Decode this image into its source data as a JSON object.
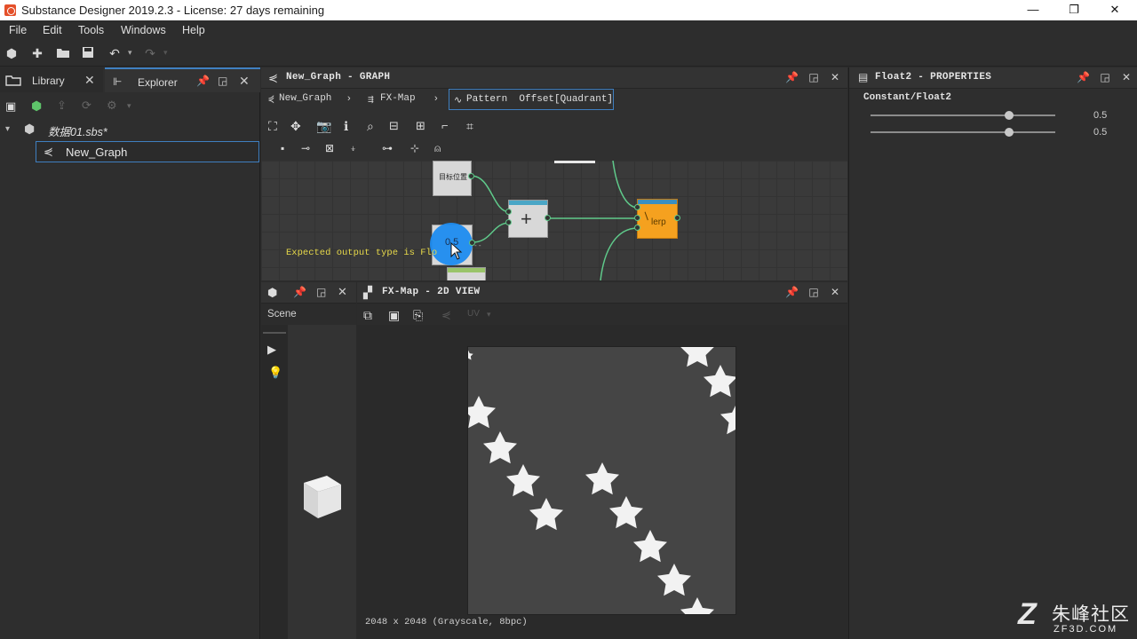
{
  "window": {
    "title": "Substance Designer 2019.2.3 - License: 27 days remaining",
    "controls": [
      "—",
      "❐",
      "✕"
    ]
  },
  "menu": [
    "File",
    "Edit",
    "Tools",
    "Windows",
    "Help"
  ],
  "left_panel": {
    "tabs": [
      {
        "label": "Library"
      },
      {
        "label": "Explorer"
      }
    ],
    "tree": {
      "file": "数据01.sbs*",
      "graph": "New_Graph"
    }
  },
  "graph_panel": {
    "title": "New_Graph - GRAPH",
    "breadcrumbs": [
      "New_Graph",
      "FX-Map",
      "Pattern  Offset[Quadrant]"
    ],
    "canvas": {
      "node_top_label": "目标位置",
      "add_symbol": "+",
      "selected_value": "0.5",
      "lerp_label": "lerp",
      "error_text": "Expected output type is Flo"
    }
  },
  "scene_panel": {
    "label": "Scene"
  },
  "view2d_panel": {
    "title": "FX-Map - 2D VIEW",
    "uv_label": "UV",
    "status": "2048 x 2048 (Grayscale, 8bpc)"
  },
  "properties_panel": {
    "title": "Float2 - PROPERTIES",
    "section": "Constant/Float2",
    "sliders": [
      {
        "value": "0.5",
        "fraction": 0.75
      },
      {
        "value": "0.5",
        "fraction": 0.75
      }
    ]
  },
  "watermark": {
    "logo": "Z",
    "cn": "朱峰社区",
    "en": "ZF3D.COM"
  },
  "colors": {
    "accent_blue": "#3f7fc0",
    "lerp_orange": "#f5a11f",
    "connector_green": "#5fc98a",
    "node_topbar_teal": "#4aa6c6",
    "selection_blue": "#1e8cf0"
  }
}
